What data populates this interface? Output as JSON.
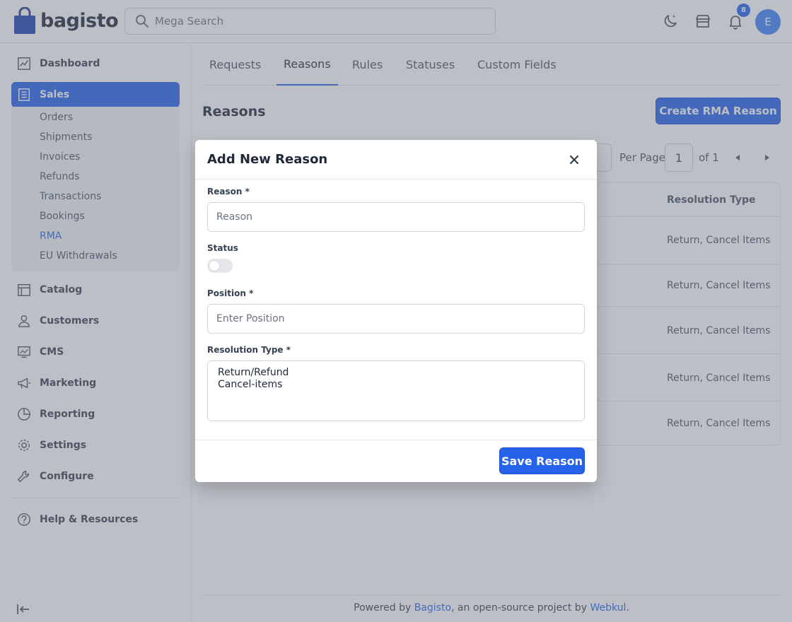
{
  "header": {
    "logo_text": "bagisto",
    "search_placeholder": "Mega Search",
    "notification_count": "8",
    "avatar_initial": "E"
  },
  "sidebar": {
    "items": [
      {
        "label": "Dashboard",
        "icon": "dashboard-icon"
      },
      {
        "label": "Sales",
        "icon": "sales-icon",
        "active": true
      },
      {
        "label": "Catalog",
        "icon": "catalog-icon"
      },
      {
        "label": "Customers",
        "icon": "customers-icon"
      },
      {
        "label": "CMS",
        "icon": "cms-icon"
      },
      {
        "label": "Marketing",
        "icon": "marketing-icon"
      },
      {
        "label": "Reporting",
        "icon": "reporting-icon"
      },
      {
        "label": "Settings",
        "icon": "settings-icon"
      },
      {
        "label": "Configure",
        "icon": "configure-icon"
      }
    ],
    "sales_sub_items": [
      "Orders",
      "Shipments",
      "Invoices",
      "Refunds",
      "Transactions",
      "Bookings",
      "RMA",
      "EU Withdrawals"
    ],
    "active_sub_item": "RMA",
    "help_label": "Help & Resources"
  },
  "main": {
    "tabs": [
      "Requests",
      "Reasons",
      "Rules",
      "Statuses",
      "Custom Fields"
    ],
    "active_tab": "Reasons",
    "page_title": "Reasons",
    "create_button": "Create RMA Reason",
    "pagination": {
      "per_page_label": "Per Page",
      "current_page": "1",
      "of_label": "of 1"
    },
    "table": {
      "visible_header": "Resolution Type",
      "rows": [
        "Return, Cancel Items",
        "Return, Cancel Items",
        "Return, Cancel Items",
        "Return, Cancel Items",
        "Return, Cancel Items"
      ]
    }
  },
  "footer": {
    "prefix": "Powered by ",
    "link1": "Bagisto",
    "middle": ", an open-source project by ",
    "link2": "Webkul",
    "suffix": "."
  },
  "modal": {
    "title": "Add New Reason",
    "reason_label": "Reason *",
    "reason_placeholder": "Reason",
    "status_label": "Status",
    "status_on": false,
    "position_label": "Position *",
    "position_placeholder": "Enter Position",
    "resolution_label": "Resolution Type *",
    "resolution_options": [
      "Return/Refund",
      "Cancel-items"
    ],
    "save_button": "Save Reason"
  },
  "colors": {
    "accent": "#2563eb",
    "overlay": "rgba(107,114,128,0.45)"
  }
}
